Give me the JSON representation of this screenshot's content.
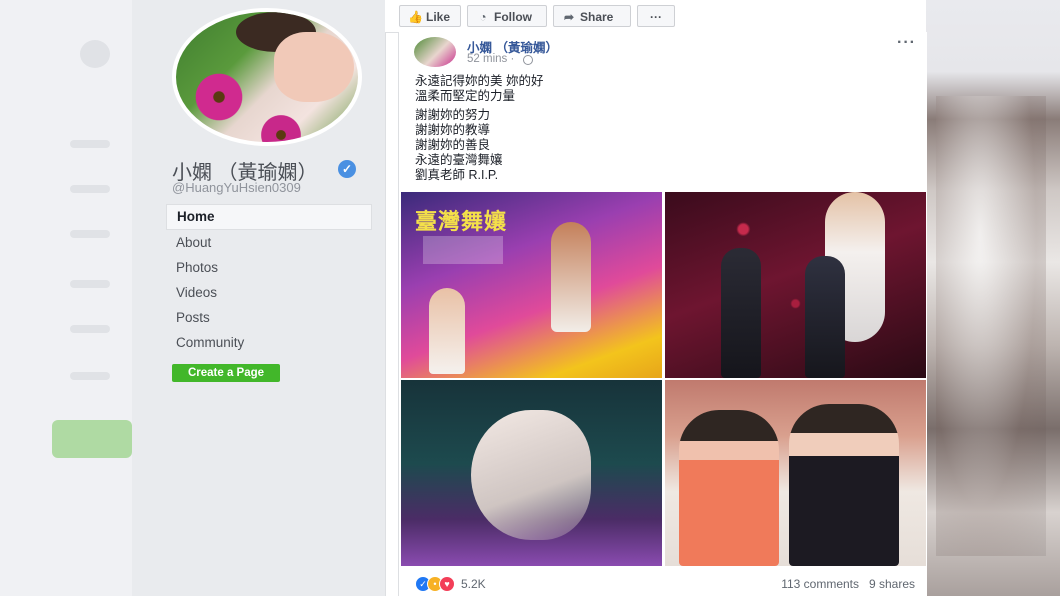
{
  "sidebar": {
    "page_name": "小嫻 （黃瑜嫻）",
    "handle": "@HuangYuHsien0309",
    "nav": [
      {
        "label": "Home",
        "active": true
      },
      {
        "label": "About"
      },
      {
        "label": "Photos"
      },
      {
        "label": "Videos"
      },
      {
        "label": "Posts"
      },
      {
        "label": "Community"
      }
    ],
    "create_page_label": "Create a Page"
  },
  "actionbar": {
    "like_label": "Like",
    "follow_label": "Follow",
    "share_label": "Share",
    "more_label": "···"
  },
  "post": {
    "author": "小嫻 （黃瑜嫻）",
    "time": "52 mins ·",
    "more": "···",
    "paragraphs": [
      [
        "永遠記得妳的美 妳的好",
        "溫柔而堅定的力量"
      ],
      [
        "謝謝妳的努力",
        "謝謝妳的教導",
        "謝謝妳的善良",
        "永遠的臺灣舞孃",
        "劉真老師 R.I.P."
      ]
    ],
    "photo1_title": "臺灣舞孃",
    "reactions_count": "5.2K",
    "comments": "113 comments",
    "shares": "9 shares"
  },
  "colors": {
    "link_blue": "#365899",
    "green_button": "#42b72a",
    "verified_blue": "#4a90e2"
  }
}
